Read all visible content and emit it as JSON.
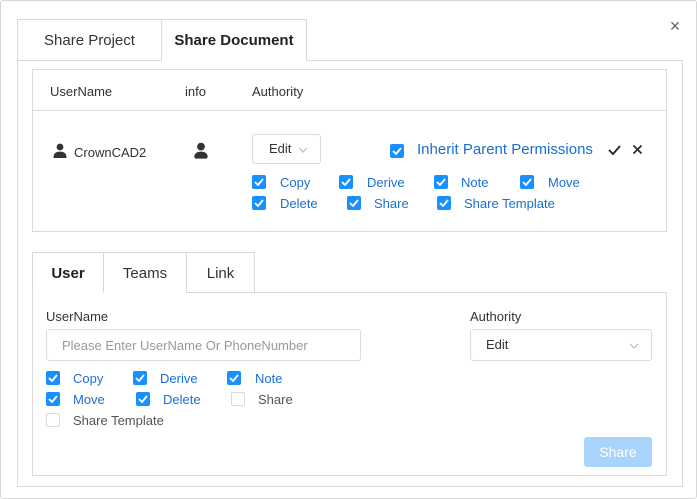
{
  "dialog": {
    "close_symbol": "×",
    "tabs": [
      {
        "label": "Share Project",
        "active": false
      },
      {
        "label": "Share Document",
        "active": true
      }
    ]
  },
  "permissions_table": {
    "headers": {
      "username": "UserName",
      "info": "info",
      "authority": "Authority"
    },
    "row": {
      "username": "CrownCAD2",
      "user_icon": "user-icon",
      "info_icon": "user-info-icon",
      "authority_select": "Edit",
      "inherit": {
        "label": "Inherit Parent Permissions",
        "checked": true
      },
      "confirm_icon": "check-icon",
      "cancel_icon": "close-icon",
      "permissions": [
        {
          "label": "Copy",
          "checked": true
        },
        {
          "label": "Derive",
          "checked": true
        },
        {
          "label": "Note",
          "checked": true
        },
        {
          "label": "Move",
          "checked": true
        },
        {
          "label": "Delete",
          "checked": true
        },
        {
          "label": "Share",
          "checked": true
        },
        {
          "label": "Share Template",
          "checked": true
        }
      ]
    }
  },
  "bottom_tabs": [
    {
      "label": "User",
      "active": true
    },
    {
      "label": "Teams",
      "active": false
    },
    {
      "label": "Link",
      "active": false
    }
  ],
  "user_form": {
    "username_label": "UserName",
    "username_placeholder": "Please Enter UserName Or PhoneNumber",
    "username_value": "",
    "authority_label": "Authority",
    "authority_value": "Edit",
    "permissions": [
      {
        "label": "Copy",
        "checked": true
      },
      {
        "label": "Derive",
        "checked": true
      },
      {
        "label": "Note",
        "checked": true
      },
      {
        "label": "Move",
        "checked": true
      },
      {
        "label": "Delete",
        "checked": true
      },
      {
        "label": "Share",
        "checked": false
      },
      {
        "label": "Share Template",
        "checked": false
      }
    ],
    "share_button": "Share"
  },
  "colors": {
    "accent": "#1890ff",
    "link_text": "#1a6fd6",
    "disabled_button": "#a8d4fb",
    "border": "#dcdcdc"
  }
}
